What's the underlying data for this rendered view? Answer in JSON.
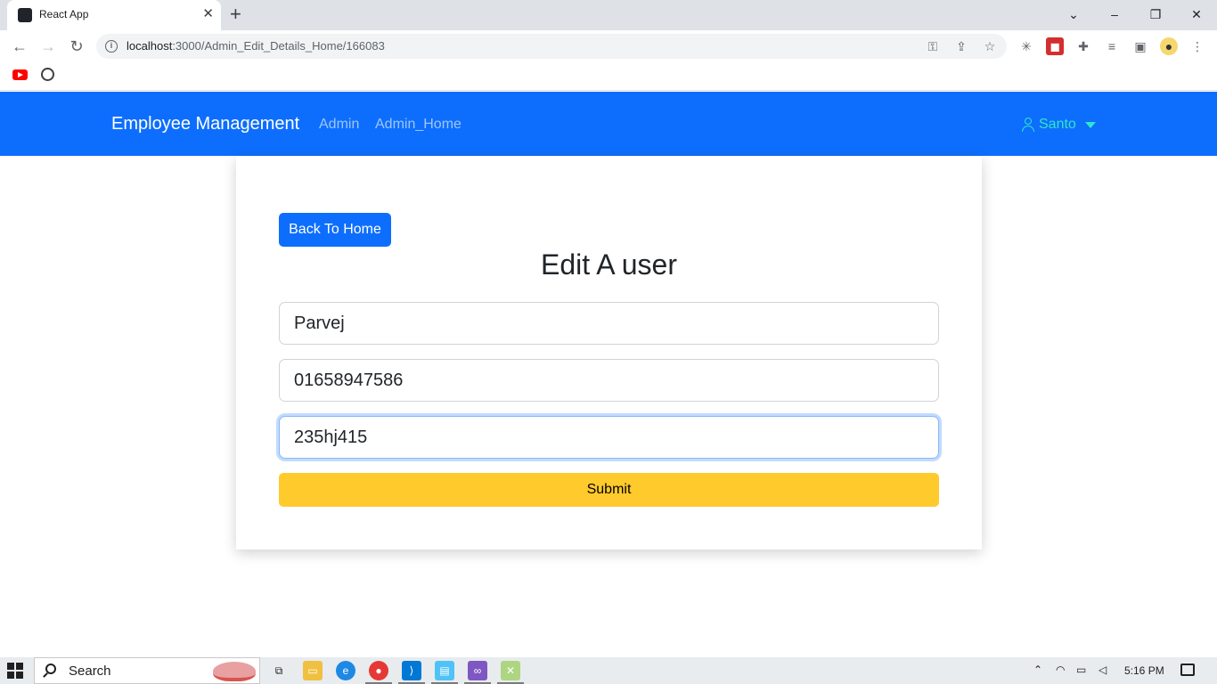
{
  "browser": {
    "tab_title": "React App",
    "url_host": "localhost",
    "url_path": ":3000/Admin_Edit_Details_Home/166083"
  },
  "navbar": {
    "brand": "Employee Management",
    "links": [
      "Admin",
      "Admin_Home"
    ],
    "user_name": "Santo"
  },
  "form": {
    "back_label": "Back To Home",
    "title": "Edit A user",
    "name_value": "Parvej",
    "phone_value": "01658947586",
    "password_value": "235hj415",
    "submit_label": "Submit"
  },
  "taskbar": {
    "search_label": "Search",
    "time": "5:16 PM"
  },
  "colors": {
    "primary": "#0d6efd",
    "warning": "#ffca2c",
    "user_accent": "#2fe7c8"
  }
}
